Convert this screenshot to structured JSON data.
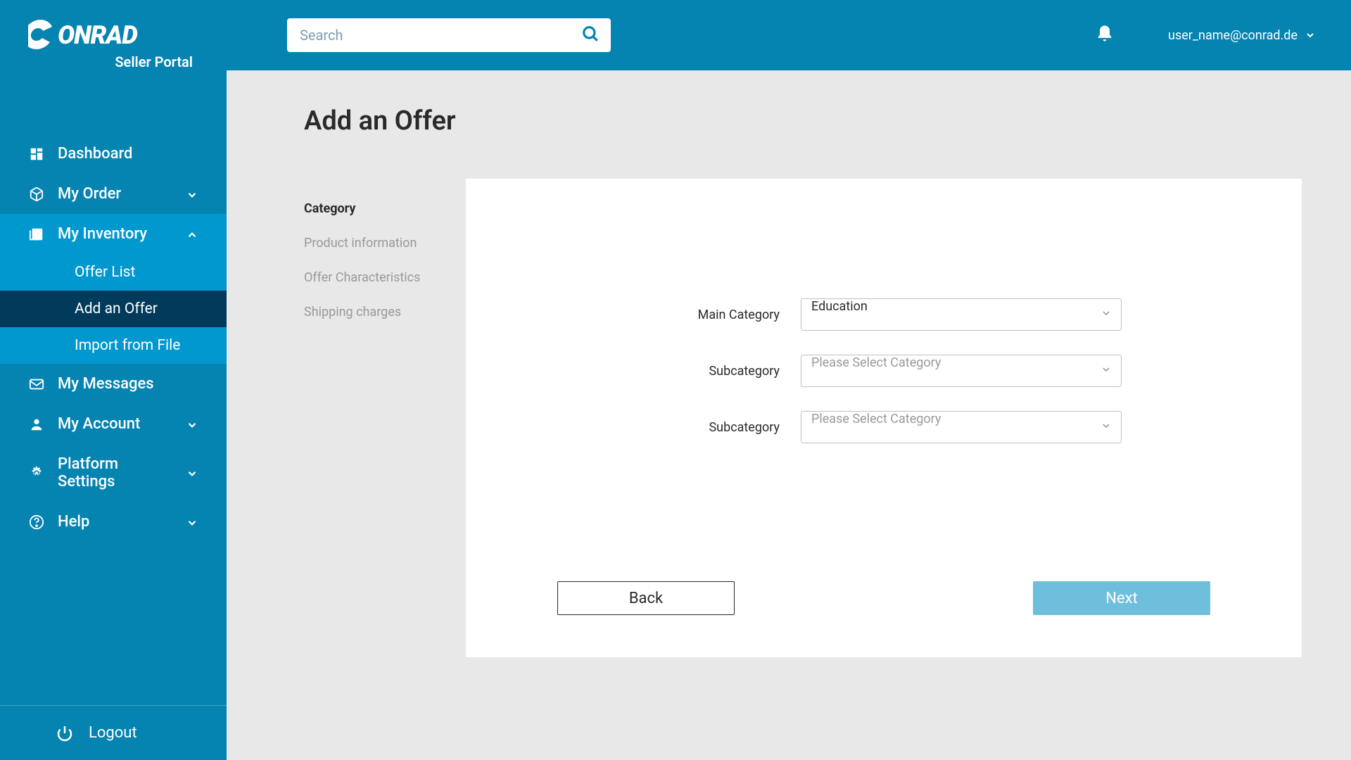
{
  "brand": {
    "name": "CONRAD",
    "subtitle": "Seller Portal"
  },
  "header": {
    "search_placeholder": "Search",
    "user_email": "user_name@conrad.de"
  },
  "sidebar": {
    "dashboard": "Dashboard",
    "my_order": "My Order",
    "my_inventory": "My Inventory",
    "inventory_sub": {
      "offer_list": "Offer List",
      "add_offer": "Add an Offer",
      "import_file": "Import from File"
    },
    "my_messages": "My Messages",
    "my_account": "My Account",
    "platform_settings": "Platform Settings",
    "help": "Help",
    "logout": "Logout"
  },
  "page": {
    "title": "Add an Offer"
  },
  "steps": {
    "category": "Category",
    "product_info": "Product information",
    "offer_characteristics": "Offer Characteristics",
    "shipping": "Shipping charges"
  },
  "form": {
    "main_category_label": "Main Category",
    "main_category_value": "Education",
    "subcategory_label": "Subcategory",
    "subcategory_placeholder": "Please Select Category"
  },
  "buttons": {
    "back": "Back",
    "next": "Next"
  }
}
